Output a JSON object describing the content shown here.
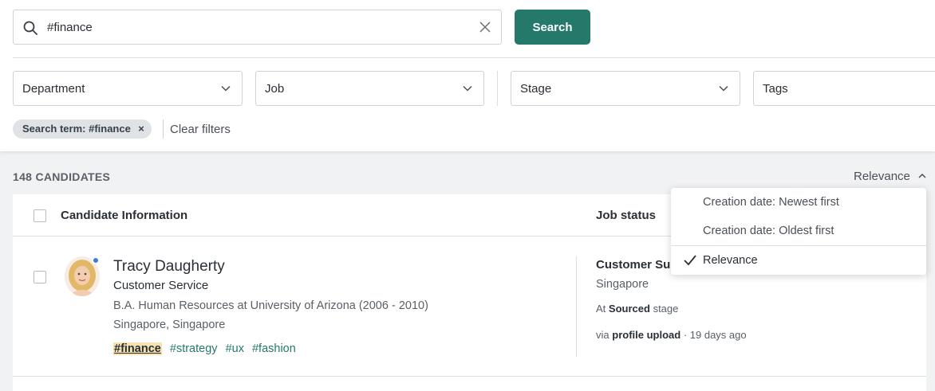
{
  "search": {
    "value": "#finance",
    "button_label": "Search"
  },
  "filters": {
    "department": "Department",
    "job": "Job",
    "stage": "Stage",
    "tags": "Tags"
  },
  "active_filters": {
    "chip_label": "Search term: #finance",
    "chip_remove": "×",
    "clear_label": "Clear filters"
  },
  "results": {
    "count_label": "148 CANDIDATES",
    "sort_label": "Relevance"
  },
  "table": {
    "headers": {
      "candidate_info": "Candidate Information",
      "job_status": "Job status"
    },
    "rows": [
      {
        "name": "Tracy Daugherty",
        "role": "Customer Service",
        "education": "B.A. Human Resources at University of Arizona (2006 - 2010)",
        "location": "Singapore, Singapore",
        "tags": [
          "#finance",
          "#strategy",
          "#ux",
          "#fashion"
        ],
        "job_title": "Customer Support",
        "job_location": "Singapore",
        "stage_prefix": "At",
        "stage_name": "Sourced",
        "stage_suffix": "stage",
        "source_prefix": "via",
        "source_name": "profile upload",
        "source_time": "· 19 days ago"
      }
    ]
  },
  "sort_menu": {
    "options": [
      "Creation date: Newest first",
      "Creation date: Oldest first",
      "Relevance"
    ],
    "selected": "Relevance"
  },
  "colors": {
    "primary": "#24796b",
    "highlight": "#f7e3b0",
    "presence": "#3d7be0"
  }
}
